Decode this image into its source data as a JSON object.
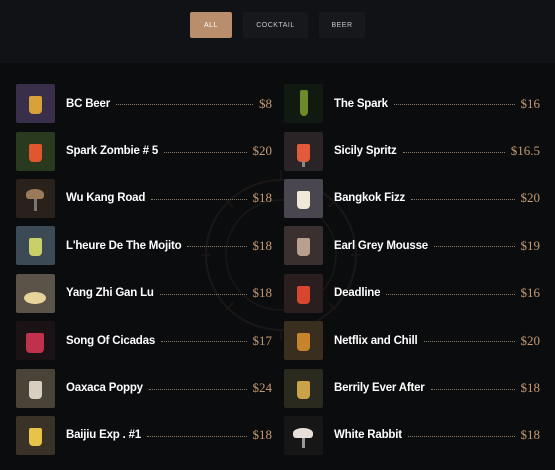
{
  "filters": [
    {
      "label": "ALL",
      "active": true
    },
    {
      "label": "COCKTAIL",
      "active": false
    },
    {
      "label": "BEER",
      "active": false
    }
  ],
  "menu": {
    "left": [
      {
        "name": "BC Beer",
        "price": "$8",
        "thumb_bg": "#3a2f4a",
        "glass": "#d9a13a"
      },
      {
        "name": "Spark Zombie # 5",
        "price": "$20",
        "thumb_bg": "#2a3a1e",
        "glass": "#e0572f"
      },
      {
        "name": "Wu Kang Road",
        "price": "$18",
        "thumb_bg": "#2b211b",
        "glass": "#9b7a5a"
      },
      {
        "name": "L'heure De The Mojito",
        "price": "$18",
        "thumb_bg": "#3b4a55",
        "glass": "#c9d06a"
      },
      {
        "name": "Yang Zhi Gan Lu",
        "price": "$18",
        "thumb_bg": "#5b5348",
        "glass": "#e8d49a"
      },
      {
        "name": "Song Of Cicadas",
        "price": "$17",
        "thumb_bg": "#1a1214",
        "glass": "#c0324b"
      },
      {
        "name": "Oaxaca Poppy",
        "price": "$24",
        "thumb_bg": "#4a4438",
        "glass": "#d8cfc0"
      },
      {
        "name": "Baijiu Exp . #1",
        "price": "$18",
        "thumb_bg": "#3a3226",
        "glass": "#e8c34a"
      }
    ],
    "right": [
      {
        "name": "The Spark",
        "price": "$16",
        "thumb_bg": "#101a10",
        "glass": "#6b8a2a"
      },
      {
        "name": "Sicily Spritz",
        "price": "$16.5",
        "thumb_bg": "#2a2426",
        "glass": "#e25a3a"
      },
      {
        "name": "Bangkok Fizz",
        "price": "$20",
        "thumb_bg": "#4a4650",
        "glass": "#f0e8d8"
      },
      {
        "name": "Earl Grey Mousse",
        "price": "$19",
        "thumb_bg": "#3a3030",
        "glass": "#b8a090"
      },
      {
        "name": "Deadline",
        "price": "$16",
        "thumb_bg": "#2a1e1e",
        "glass": "#d9462f"
      },
      {
        "name": "Netflix and Chill",
        "price": "$20",
        "thumb_bg": "#3a2e1e",
        "glass": "#c8842a"
      },
      {
        "name": "Berrily Ever After",
        "price": "$18",
        "thumb_bg": "#2a2a1e",
        "glass": "#c9a24a"
      },
      {
        "name": "White Rabbit",
        "price": "$18",
        "thumb_bg": "#161616",
        "glass": "#e8e0d8"
      }
    ]
  },
  "colors": {
    "background": "#0b0c0e",
    "accent": "#b98e6c",
    "price": "#c49a72"
  }
}
